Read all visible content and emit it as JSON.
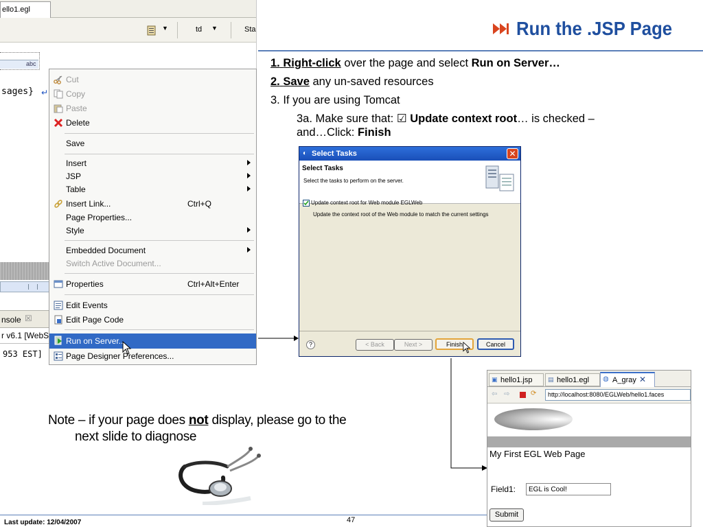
{
  "slide": {
    "title": "Run the .JSP Page",
    "steps": {
      "s1_num": "1.",
      "s1_bold": "Right-click",
      "s1_mid": "over the page and select",
      "s1_bold2": "Run on Server…",
      "s2_num": "2.",
      "s2_bold": "Save",
      "s2_rest": "any un-saved resources",
      "s3": "3. If you are using Tomcat",
      "s3a_pre": "3a. Make sure that: ☑",
      "s3a_bold": "Update context root",
      "s3a_rest": "…  is checked –",
      "s3a_line2_pre": "and…Click:",
      "s3a_line2_bold": "Finish"
    },
    "note_pre": "Note – if your page does",
    "note_bold": "not",
    "note_post": "display, please go to the",
    "note_line2": "next slide to diagnose",
    "footer_last_update": "Last update: 12/04/2007",
    "footer_page": "47"
  },
  "editor": {
    "file_tab": "ello1.egl",
    "toolbar_td": "td",
    "toolbar_sta": "Sta",
    "abc_label": "abc",
    "code_fragment": "sages}",
    "console_tab": "nsole",
    "console_close": "☒",
    "console_line1": "r v6.1 [WebS",
    "console_line2": "953 EST]"
  },
  "context_menu": {
    "cut": "Cut",
    "copy": "Copy",
    "paste": "Paste",
    "delete": "Delete",
    "save": "Save",
    "insert": "Insert",
    "jsp": "JSP",
    "table": "Table",
    "insert_link": "Insert Link...",
    "insert_link_key": "Ctrl+Q",
    "page_properties": "Page Properties...",
    "style": "Style",
    "embedded_document": "Embedded Document",
    "switch_active_document": "Switch Active Document...",
    "properties": "Properties",
    "properties_key": "Ctrl+Alt+Enter",
    "edit_events": "Edit Events",
    "edit_page_code": "Edit Page Code",
    "run_on_server": "Run on Server...",
    "page_designer_preferences": "Page Designer Preferences..."
  },
  "dialog": {
    "window_title": "Select Tasks",
    "heading": "Select Tasks",
    "subheading": "Select the tasks to perform on the server.",
    "checkbox_label": "Update context root for Web module EGLWeb",
    "checkbox_checked": true,
    "description": "Update the context root of the Web module to match the current settings",
    "help": "?",
    "back": "< Back",
    "next": "Next >",
    "finish": "Finish",
    "cancel": "Cancel"
  },
  "browser": {
    "tab1": "hello1.jsp",
    "tab2": "hello1.egl",
    "tab3": "A_gray",
    "url": "http://localhost:8080/EGLWeb/hello1.faces",
    "page_heading": "My First EGL Web Page",
    "field_label": "Field1:",
    "field_value": "EGL is Cool!",
    "submit": "Submit"
  },
  "colors": {
    "title_blue": "#1f4f9f",
    "rule_blue": "#5a7fb8",
    "menu_highlight": "#316ac5",
    "dialog_titlebar": "#1a4fb8",
    "close_red": "#d9451f"
  }
}
